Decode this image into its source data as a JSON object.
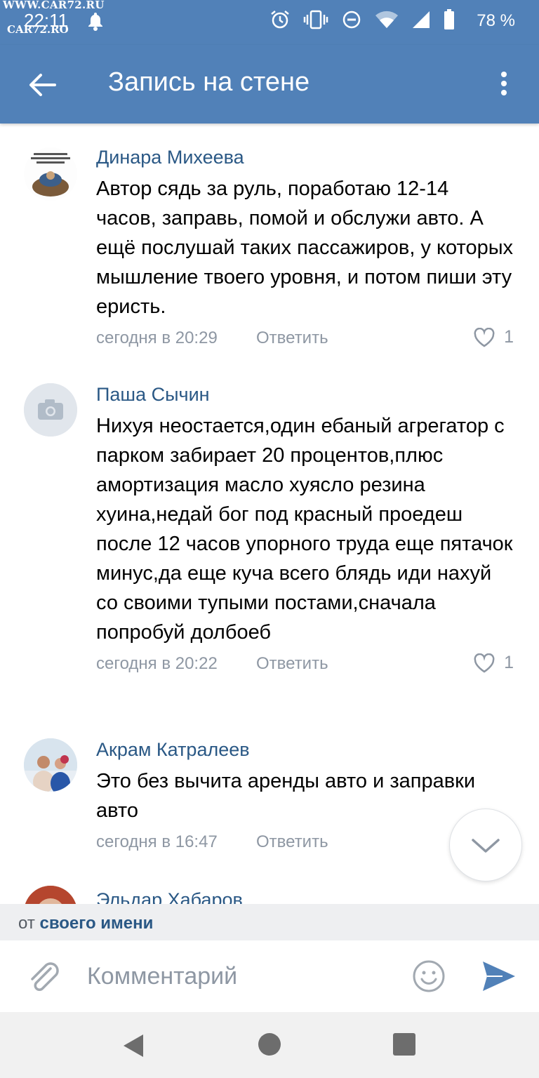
{
  "status_bar": {
    "watermark_top": "WWW.CAR72.RU",
    "time": "22:11",
    "watermark_bottom": "CAR72.RO",
    "battery_percent": "78 %",
    "icons": [
      "bell-icon",
      "alarm-icon",
      "vibrate-icon",
      "dnd-icon",
      "wifi-icon",
      "signal-icon",
      "battery-icon"
    ]
  },
  "appbar": {
    "title": "Запись на стене"
  },
  "comments": [
    {
      "author": "Динара Михеева",
      "text": "Автор сядь за руль, поработаю 12-14 часов, заправь, помой и обслужи авто. А ещё послушай таких пассажиров, у которых мышление твоего уровня, и потом пиши эту еристь.",
      "time": "сегодня в 20:29",
      "reply": "Ответить",
      "likes": "1"
    },
    {
      "author": "Паша Сычин",
      "text": "Нихуя неостается,один ебаный агрегатор с парком забирает 20 процентов,плюс амортизация масло хуясло резина хуина,недай бог под красный проедеш после 12 часов упорного труда еще пятачок минус,да еще куча всего блядь иди нахуй со своими тупыми постами,сначала попробуй долбоеб",
      "time": "сегодня в 20:22",
      "reply": "Ответить",
      "likes": "1"
    },
    {
      "author": "Акрам Катралеев",
      "text": "Это без вычита аренды авто и заправки авто",
      "time": "сегодня в 16:47",
      "reply": "Ответить",
      "likes": ""
    },
    {
      "author": "Эльдар Хабаров",
      "text": "",
      "time": "",
      "reply": "",
      "likes": ""
    }
  ],
  "composer": {
    "from_prefix": "от",
    "from_link": "своего имени",
    "placeholder": "Комментарий"
  },
  "colors": {
    "brand": "#5181b8",
    "link": "#2a5885",
    "meta": "#8e97a3"
  }
}
